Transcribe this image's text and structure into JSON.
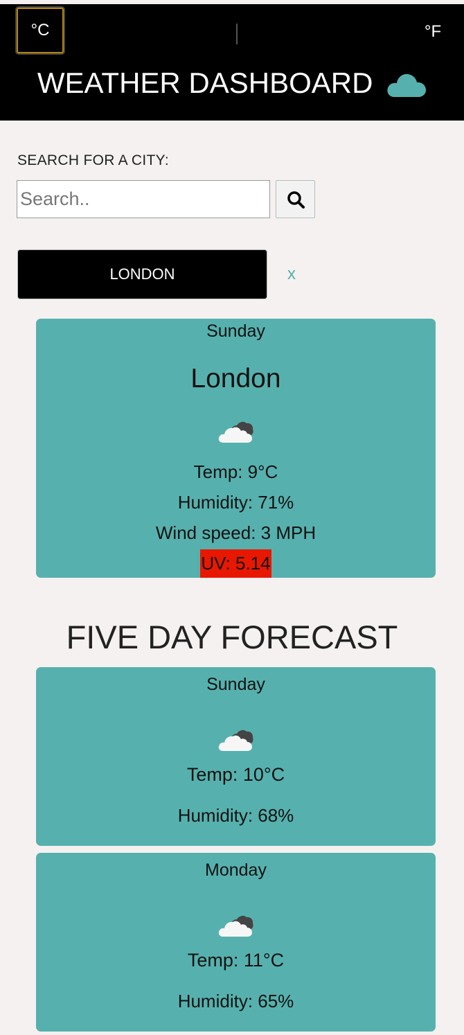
{
  "header": {
    "unit_celsius": "°C",
    "unit_fahrenheit": "°F",
    "title": "WEATHER DASHBOARD",
    "title_icon": "cloud-icon",
    "accent_color": "#56b1ae"
  },
  "search": {
    "label": "SEARCH FOR A CITY:",
    "placeholder": "Search..",
    "value": "",
    "button_icon": "search-icon"
  },
  "history": [
    {
      "city": "LONDON",
      "remove_label": "x"
    }
  ],
  "current": {
    "day": "Sunday",
    "city": "London",
    "icon": "broken-clouds-icon",
    "temp": "Temp: 9°C",
    "humidity": "Humidity: 71%",
    "wind": "Wind speed: 3 MPH",
    "uv": "UV: 5.14",
    "uv_color": "#e81800"
  },
  "forecast": {
    "title": "FIVE DAY FORECAST",
    "days": [
      {
        "day": "Sunday",
        "icon": "broken-clouds-icon",
        "temp": "Temp: 10°C",
        "humidity": "Humidity: 68%"
      },
      {
        "day": "Monday",
        "icon": "broken-clouds-icon",
        "temp": "Temp: 11°C",
        "humidity": "Humidity: 65%"
      }
    ]
  }
}
